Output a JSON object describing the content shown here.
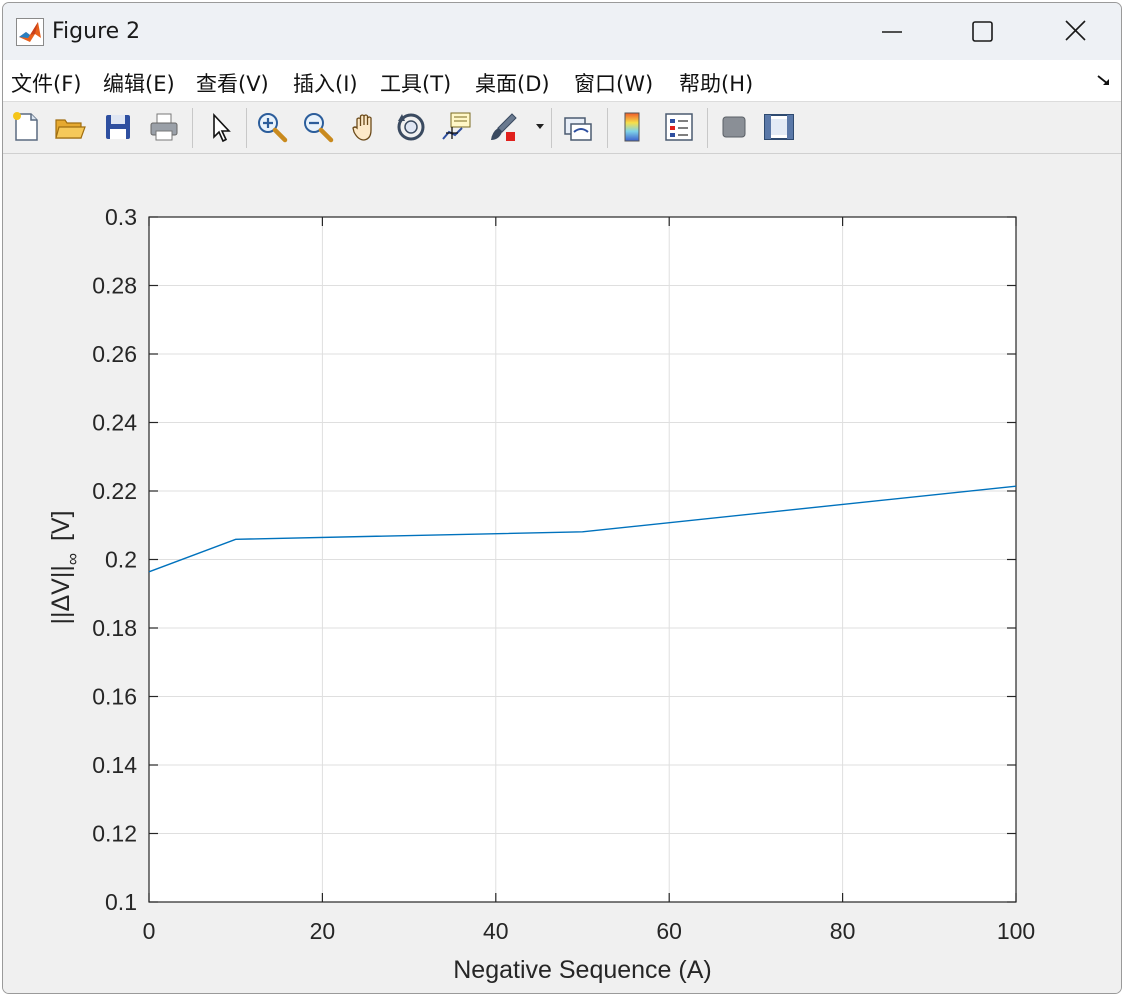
{
  "window": {
    "title": "Figure 2"
  },
  "menubar": {
    "items": [
      {
        "label": "文件(F)"
      },
      {
        "label": "编辑(E)"
      },
      {
        "label": "查看(V)"
      },
      {
        "label": "插入(I)"
      },
      {
        "label": "工具(T)"
      },
      {
        "label": "桌面(D)"
      },
      {
        "label": "窗口(W)"
      },
      {
        "label": "帮助(H)"
      }
    ]
  },
  "toolbar": {
    "icons": [
      "new-figure-icon",
      "open-icon",
      "save-icon",
      "print-icon",
      "pointer-icon",
      "zoom-in-icon",
      "zoom-out-icon",
      "pan-icon",
      "rotate-3d-icon",
      "data-cursor-icon",
      "brush-icon",
      "link-plot-icon",
      "colorbar-icon",
      "legend-icon",
      "hide-plot-tools-icon",
      "show-plot-tools-icon"
    ]
  },
  "colors": {
    "line": "#0072bd",
    "grid": "#dfdfdf",
    "axis": "#262626",
    "figure_bg": "#f0f0f0"
  },
  "chart_data": {
    "type": "line",
    "title": "",
    "xlabel": "Negative Sequence (A)",
    "ylabel_main": "||ΔV||",
    "ylabel_sub": "∞",
    "ylabel_unit": "[V]",
    "xlim": [
      0,
      100
    ],
    "ylim": [
      0.1,
      0.3
    ],
    "xticks": [
      0,
      20,
      40,
      60,
      80,
      100
    ],
    "xtick_labels": [
      "0",
      "20",
      "40",
      "60",
      "80",
      "100"
    ],
    "yticks": [
      0.1,
      0.12,
      0.14,
      0.16,
      0.18,
      0.2,
      0.22,
      0.24,
      0.26,
      0.28,
      0.3
    ],
    "ytick_labels": [
      "0.1",
      "0.12",
      "0.14",
      "0.16",
      "0.18",
      "0.2",
      "0.22",
      "0.24",
      "0.26",
      "0.28",
      "0.3"
    ],
    "grid": true,
    "series": [
      {
        "x": [
          0,
          10,
          50,
          100
        ],
        "y": [
          0.1964,
          0.2059,
          0.2081,
          0.2214
        ]
      }
    ]
  }
}
